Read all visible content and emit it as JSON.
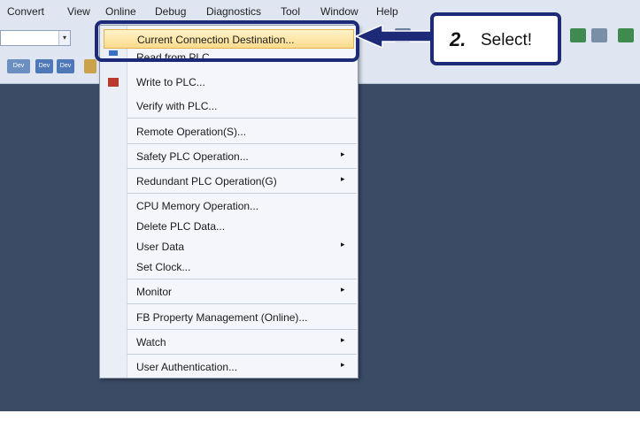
{
  "menubar": {
    "items": [
      {
        "label": "Convert"
      },
      {
        "label": "View"
      },
      {
        "label": "Online"
      },
      {
        "label": "Debug"
      },
      {
        "label": "Diagnostics"
      },
      {
        "label": "Tool"
      },
      {
        "label": "Window"
      },
      {
        "label": "Help"
      }
    ]
  },
  "online_menu": {
    "highlighted": "Current Connection Destination...",
    "partial_item": "Read from PLC...",
    "items": [
      {
        "label": "Write to PLC...",
        "submenu": false
      },
      {
        "label": "Verify with PLC...",
        "submenu": false
      },
      {
        "label": "Remote Operation(S)...",
        "submenu": false
      },
      {
        "label": "Safety PLC Operation...",
        "submenu": true
      },
      {
        "label": "Redundant PLC Operation(G)",
        "submenu": true
      },
      {
        "label": "CPU Memory Operation...",
        "submenu": false
      },
      {
        "label": "Delete PLC Data...",
        "submenu": false
      },
      {
        "label": "User Data",
        "submenu": true
      },
      {
        "label": "Set Clock...",
        "submenu": false
      },
      {
        "label": "Monitor",
        "submenu": true
      },
      {
        "label": "FB Property Management (Online)...",
        "submenu": false
      },
      {
        "label": "Watch",
        "submenu": true
      },
      {
        "label": "User Authentication...",
        "submenu": true
      }
    ]
  },
  "callout": {
    "number": "2.",
    "text": "Select!"
  },
  "toolbar": {
    "dev_label": "Dev"
  },
  "icons": {
    "submenu_arrow": "▸",
    "combo_arrow": "▾"
  },
  "colors": {
    "workspace": "#3b4b66",
    "highlight": "#fbdb8d",
    "annotation": "#1d2a78"
  }
}
